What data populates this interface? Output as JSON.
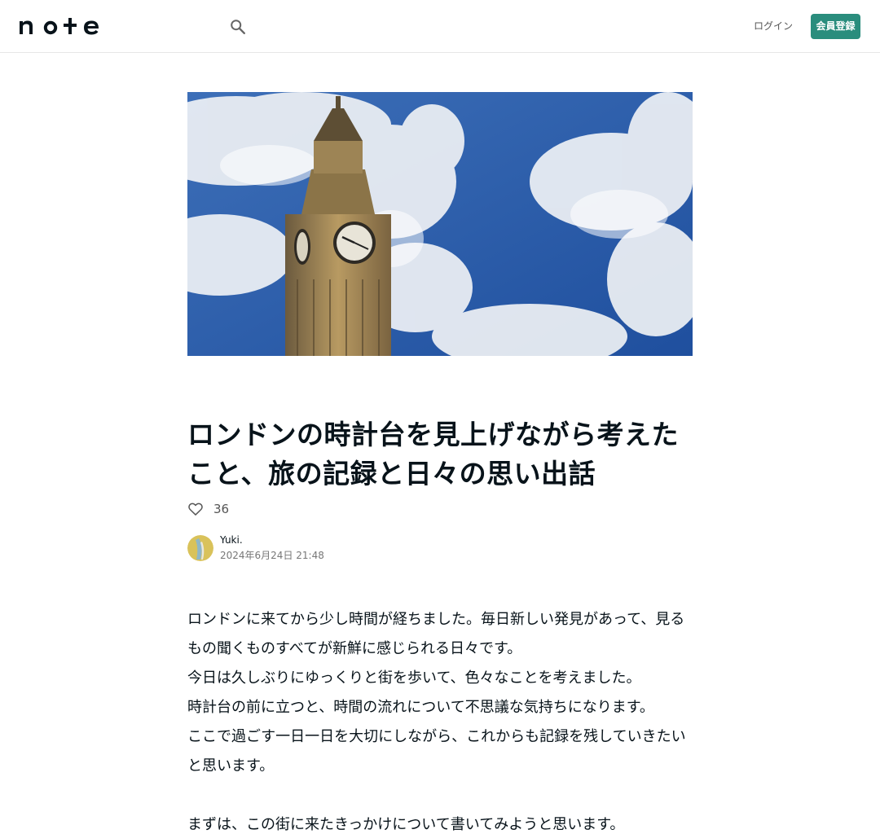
{
  "header": {
    "logo_text": "note",
    "search_icon": "search-icon",
    "login_label": "ログイン",
    "signup_label": "会員登録"
  },
  "hero": {
    "image_desc": "Big Ben clock tower against a blue sky with white clouds"
  },
  "article": {
    "title": "ロンドンの時計台を見上げながら考えたこと、旅の記録と日々の思い出話",
    "likes": "36",
    "like_icon": "heart-outline-icon"
  },
  "author": {
    "name": "Yuki.",
    "date": "2024年6月24日 21:48"
  },
  "body": {
    "paragraphs": [
      "ロンドンに来てから少し時間が経ちました。毎日新しい発見があって、見るもの聞くものすべてが新鮮に感じられる日々です。",
      "今日は久しぶりにゆっくりと街を歩いて、色々なことを考えました。",
      "時計台の前に立つと、時間の流れについて不思議な気持ちになります。",
      "ここで過ごす一日一日を大切にしながら、これからも記録を残していきたいと思います。",
      "",
      "まずは、この街に来たきっかけについて書いてみようと思います。"
    ]
  },
  "colors": {
    "accent": "#2a8d7d",
    "text": "#08131a",
    "muted": "#555555"
  }
}
